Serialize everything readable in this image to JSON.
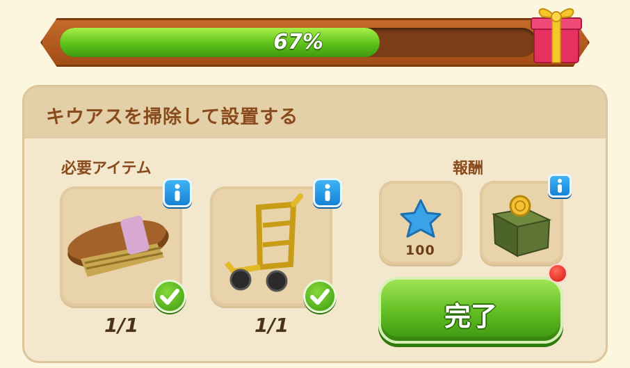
{
  "progress": {
    "percent_label": "67%",
    "fraction": 0.67
  },
  "quest": {
    "title": "キウアスを掃除して設置する"
  },
  "required": {
    "label": "必要アイテム",
    "items": [
      {
        "icon": "brush-icon",
        "count": "1/1",
        "complete": true
      },
      {
        "icon": "hand-truck-icon",
        "count": "1/1",
        "complete": true
      }
    ]
  },
  "reward": {
    "label": "報酬",
    "items": [
      {
        "icon": "blue-star-icon",
        "value": "100"
      },
      {
        "icon": "coin-box-icon"
      }
    ]
  },
  "complete_button": {
    "label": "完了"
  },
  "colors": {
    "accent_green": "#5fbd21",
    "frame_brown": "#a24d16",
    "text_brown": "#8a4b1c",
    "info_blue": "#1583d6",
    "notification_red": "#d71810"
  }
}
